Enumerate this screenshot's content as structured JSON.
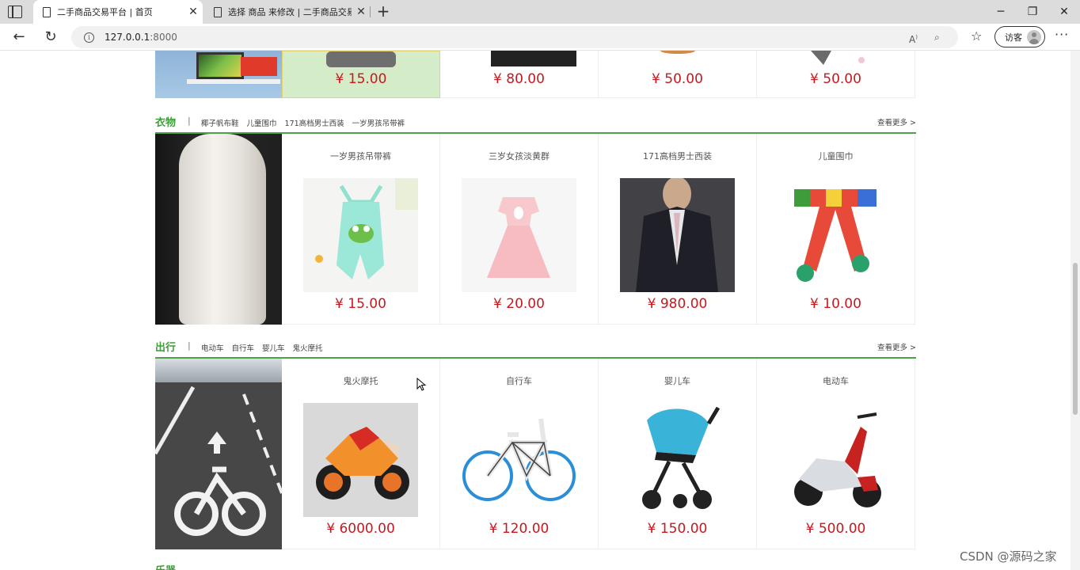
{
  "browser": {
    "tabs": [
      {
        "title": "二手商品交易平台 | 首页",
        "active": true
      },
      {
        "title": "选择 商品 来修改 | 二手商品交易",
        "active": false
      }
    ],
    "url_host": "127.0.0.1",
    "url_port": ":8000",
    "profile_label": "访客",
    "icons": [
      "tab-actions-icon",
      "page-icon",
      "close-icon",
      "plus-icon",
      "minimize-icon",
      "maximize-icon",
      "close-window-icon",
      "back-icon",
      "refresh-icon",
      "info-icon",
      "read-aloud-icon",
      "zoom-icon",
      "favorites-icon",
      "avatar-icon",
      "more-icon"
    ]
  },
  "top_row": {
    "prices": [
      "¥ 15.00",
      "¥ 80.00",
      "¥ 50.00",
      "¥ 50.00"
    ]
  },
  "sections": [
    {
      "title": "衣物",
      "separator": "|",
      "tags": [
        "椰子帆布鞋",
        "儿童围巾",
        "171高档男士西装",
        "一岁男孩吊带裤"
      ],
      "more": "查看更多 >",
      "products": [
        {
          "name": "一岁男孩吊带裤",
          "price": "¥ 15.00"
        },
        {
          "name": "三岁女孩淡黄群",
          "price": "¥ 20.00"
        },
        {
          "name": "171高档男士西装",
          "price": "¥ 980.00"
        },
        {
          "name": "儿童围巾",
          "price": "¥ 10.00"
        }
      ]
    },
    {
      "title": "出行",
      "separator": "|",
      "tags": [
        "电动车",
        "自行车",
        "婴儿车",
        "鬼火摩托"
      ],
      "more": "查看更多 >",
      "products": [
        {
          "name": "鬼火摩托",
          "price": "¥ 6000.00"
        },
        {
          "name": "自行车",
          "price": "¥ 120.00"
        },
        {
          "name": "婴儿车",
          "price": "¥ 150.00"
        },
        {
          "name": "电动车",
          "price": "¥ 500.00"
        }
      ]
    }
  ],
  "next_section_peek": "乐器",
  "watermark": "CSDN @源码之家",
  "colors": {
    "accent_green": "#3f9c39",
    "price_red": "#c8181e",
    "highlight_bg": "#d5ecc9"
  }
}
